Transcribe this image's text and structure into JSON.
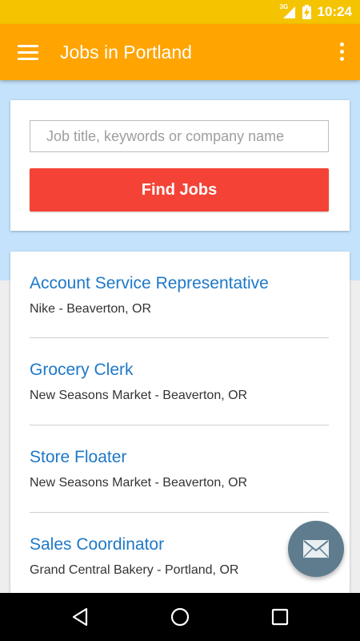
{
  "status_bar": {
    "network": "3G",
    "time": "10:24"
  },
  "app_bar": {
    "title": "Jobs in Portland",
    "menu_icon": "hamburger-menu-icon",
    "overflow_icon": "more-vert-icon"
  },
  "search": {
    "placeholder": "Job title, keywords or company name",
    "value": "",
    "button_label": "Find Jobs"
  },
  "jobs": [
    {
      "title": "Account Service Representative",
      "company_location": "Nike - Beaverton, OR"
    },
    {
      "title": "Grocery Clerk",
      "company_location": "New Seasons Market - Beaverton, OR"
    },
    {
      "title": "Store Floater",
      "company_location": "New Seasons Market - Beaverton, OR"
    },
    {
      "title": "Sales Coordinator",
      "company_location": "Grand Central Bakery - Portland, OR"
    }
  ],
  "fab": {
    "icon": "mail-icon"
  },
  "nav_bar": {
    "back_icon": "back-icon",
    "home_icon": "home-icon",
    "recents_icon": "recents-icon"
  },
  "colors": {
    "status_bar": "#f5c400",
    "app_bar": "#ffa400",
    "hero_background": "#c4e2fb",
    "find_button": "#f44336",
    "job_title_link": "#1e78c8",
    "fab": "#5e7c8e"
  }
}
